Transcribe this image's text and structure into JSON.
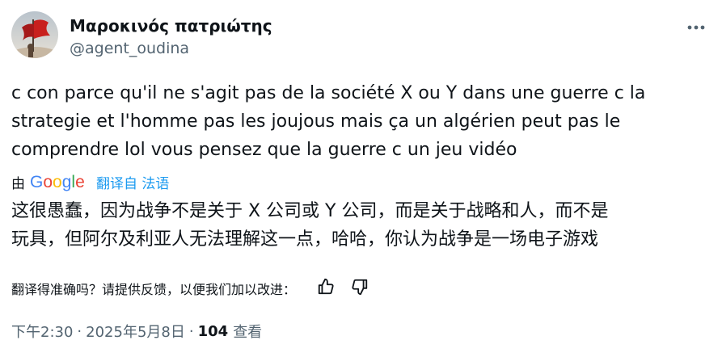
{
  "author": {
    "name": "Μαροκινός πατριώτης",
    "handle": "@agent_oudina"
  },
  "tweet": {
    "lines": [
      "c con parce qu'il ne s'agit pas de la société X ou Y dans une guerre c la",
      "strategie et l'homme pas les joujous mais ça un algérien peut pas le",
      "comprendre lol vous pensez que la guerre c un jeu vidéo"
    ]
  },
  "translation": {
    "by_label": "由",
    "provider": "Google",
    "link_label": "翻译自 法语",
    "lines": [
      "这很愚蠢，因为战争不是关于 X 公司或 Y 公司，而是关于战略和人，而不是",
      "玩具，但阿尔及利亚人无法理解这一点，哈哈，你认为战争是一场电子游戏"
    ],
    "feedback_label": "翻译得准确吗？请提供反馈，以便我们加以改进："
  },
  "meta": {
    "time": "下午2:30",
    "separator": "·",
    "date": "2025年5月8日",
    "views_count": "104",
    "views_label": "查看"
  },
  "icons": {
    "more": "more-horizontal-icon",
    "thumbs_up": "thumbs-up-icon",
    "thumbs_down": "thumbs-down-icon"
  },
  "colors": {
    "text": "#0f1419",
    "secondary": "#536471",
    "link": "#1d9bf0"
  }
}
